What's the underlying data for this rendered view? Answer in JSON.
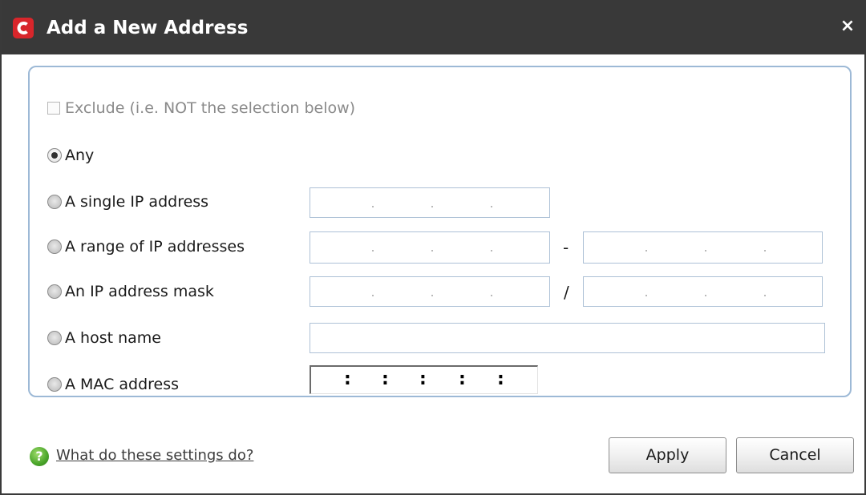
{
  "window": {
    "title": "Add a New Address",
    "close_glyph": "×",
    "logo_icon": "comodo-logo-icon",
    "titlebar_color": "#393939",
    "logo_color": "#d8262b"
  },
  "exclude": {
    "label": "Exclude (i.e. NOT the selection below)",
    "checked": false,
    "enabled": false
  },
  "options": {
    "any": {
      "label": "Any",
      "selected": true
    },
    "single_ip": {
      "label": "A single IP address",
      "selected": false
    },
    "ip_range": {
      "label": "A range of IP addresses",
      "selected": false,
      "separator": "-"
    },
    "ip_mask": {
      "label": "An IP address mask",
      "selected": false,
      "separator": "/"
    },
    "host_name": {
      "label": "A host name",
      "selected": false,
      "value": ""
    },
    "mac_address": {
      "label": "A MAC address",
      "selected": false,
      "separator": ":"
    }
  },
  "footer": {
    "help_icon": "question-help-icon",
    "help_icon_glyph": "?",
    "help_link": "What do these settings do?",
    "apply_label": "Apply",
    "cancel_label": "Cancel"
  }
}
